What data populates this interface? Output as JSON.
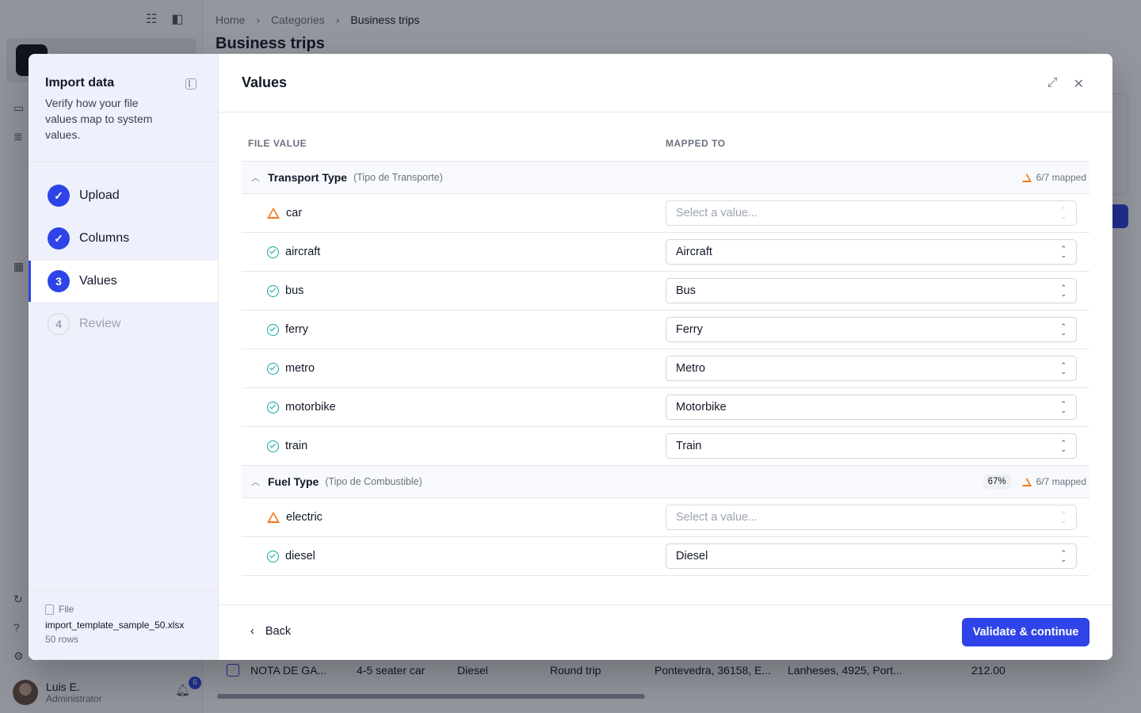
{
  "background": {
    "breadcrumb": [
      "Home",
      "Categories",
      "Business trips"
    ],
    "page_title": "Business trips",
    "user": {
      "name": "Luis E.",
      "role": "Administrator",
      "notifications": "6"
    },
    "table_row": [
      "NOTA DE GA...",
      "4-5 seater car",
      "Diesel",
      "Round trip",
      "Pontevedra, 36158, E...",
      "Lanheses, 4925, Port...",
      "212.00"
    ]
  },
  "wizard": {
    "title": "Import data",
    "subtitle": "Verify how your file values map to system values.",
    "steps": [
      {
        "num": "✓",
        "label": "Upload"
      },
      {
        "num": "✓",
        "label": "Columns"
      },
      {
        "num": "3",
        "label": "Values"
      },
      {
        "num": "4",
        "label": "Review"
      }
    ],
    "file": {
      "label": "File",
      "name": "import_template_sample_50.xlsx",
      "rows": "50 rows"
    }
  },
  "content": {
    "title": "Values",
    "col_file_value": "FILE VALUE",
    "col_mapped_to": "MAPPED TO",
    "groups": [
      {
        "name": "Transport Type",
        "alias": "(Tipo de Transporte)",
        "percent": "",
        "mapped": "6/7 mapped",
        "rows": [
          {
            "value": "car",
            "status": "warning",
            "mapped": "",
            "placeholder": "Select a value..."
          },
          {
            "value": "aircraft",
            "status": "ok",
            "mapped": "Aircraft"
          },
          {
            "value": "bus",
            "status": "ok",
            "mapped": "Bus"
          },
          {
            "value": "ferry",
            "status": "ok",
            "mapped": "Ferry"
          },
          {
            "value": "metro",
            "status": "ok",
            "mapped": "Metro"
          },
          {
            "value": "motorbike",
            "status": "ok",
            "mapped": "Motorbike"
          },
          {
            "value": "train",
            "status": "ok",
            "mapped": "Train"
          }
        ]
      },
      {
        "name": "Fuel Type",
        "alias": "(Tipo de Combustible)",
        "percent": "67%",
        "mapped": "6/7 mapped",
        "rows": [
          {
            "value": "electric",
            "status": "warning",
            "mapped": "",
            "placeholder": "Select a value..."
          },
          {
            "value": "diesel",
            "status": "ok",
            "mapped": "Diesel"
          }
        ]
      }
    ],
    "back_label": "Back",
    "continue_label": "Validate & continue"
  },
  "colors": {
    "accent": "#2f44e8",
    "ok": "#0ea5a0",
    "warning": "#f97316"
  }
}
